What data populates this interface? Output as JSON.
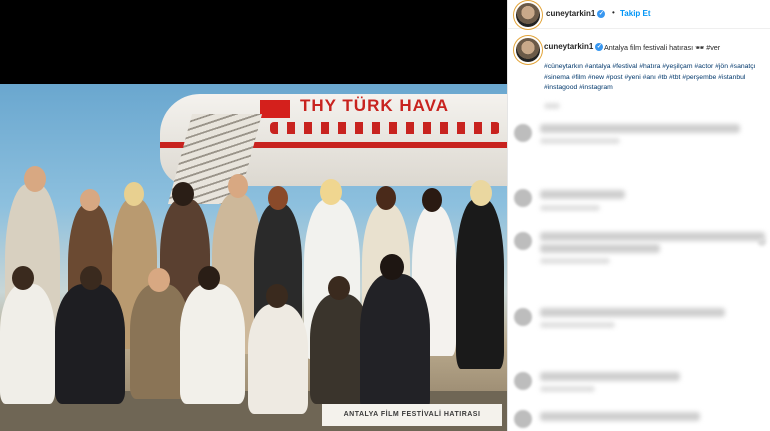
{
  "post": {
    "username": "cuneytarkin1",
    "verified_glyph": "✓",
    "follow_label": "Takip Et",
    "separator": "•",
    "caption_text": "Antalya film festivali hatırası 🕶 #ver",
    "hashtags": "#cüneytarkın #antalya #festival #hatıra #yeşilçam #actor #jön #sanatçı #sinema #film #new #post #yeni #anı #tb #tbt #perşembe #istanbul #instagood #instagram",
    "verified_color": "#3897f0",
    "follow_color": "#0095f6"
  },
  "photo": {
    "plane_text": "THY TÜRK HAVA",
    "card_caption": "ANTALYA FİLM FESTİVALİ HATIRASI"
  },
  "icons": {
    "verified": "verified-badge-icon",
    "avatar": "profile-avatar"
  }
}
